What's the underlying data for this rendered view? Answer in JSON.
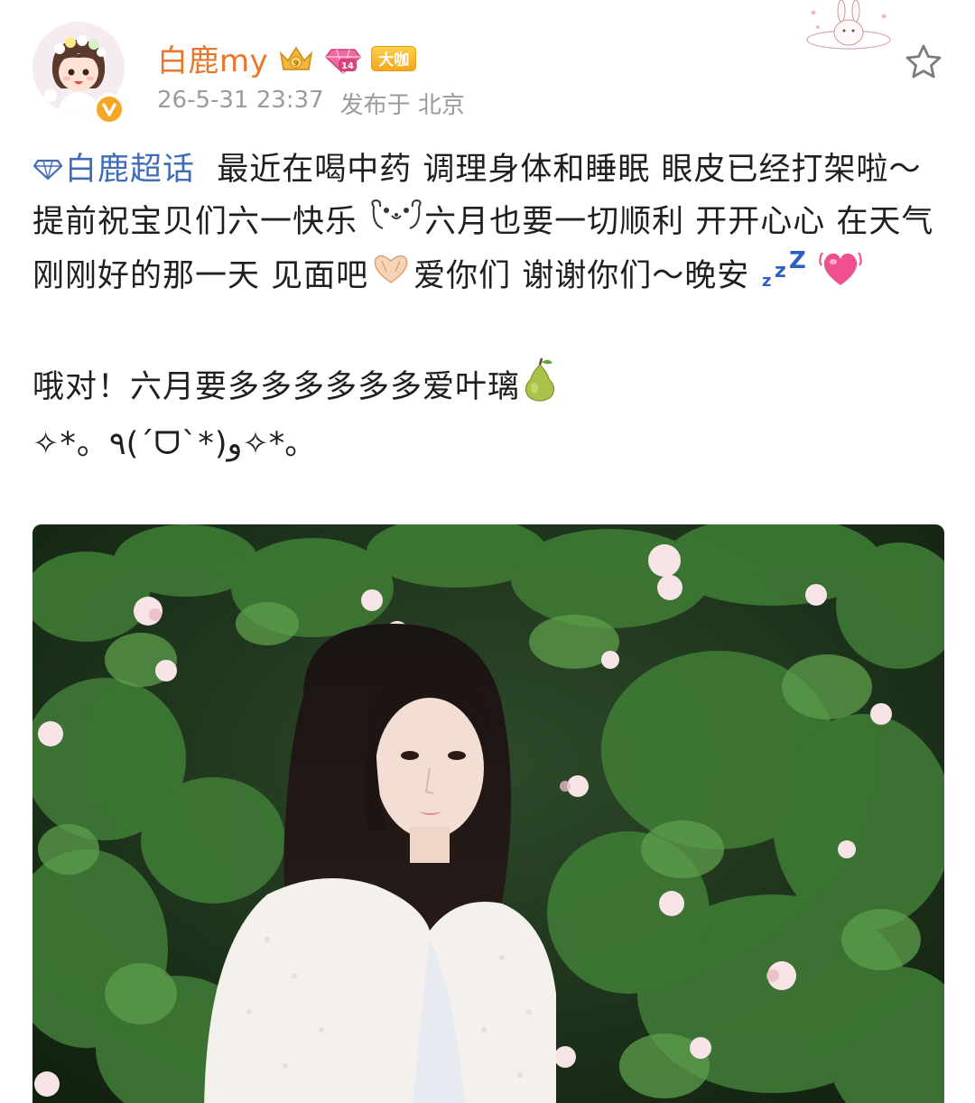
{
  "header": {
    "username": "白鹿my",
    "level_badge": "14",
    "daka_badge": "大咖",
    "timestamp": "26-5-31 23:37",
    "location": "发布于 北京"
  },
  "post": {
    "topic": "白鹿超话",
    "line1_rest": "最近在喝中药 调理身体和睡眠 眼皮已经打架啦～提前祝宝贝们六一快乐",
    "line2": "六月也要一切顺利 开开心心 在天气刚刚好的那一天 见面吧",
    "line3": "爱你们 谢谢你们～晚安",
    "para2": "哦对！六月要多多多多多多爱叶璃",
    "para3": "✧*。٩(ˊᗜˋ*)و✧*。"
  },
  "colors": {
    "username": "#e8772d",
    "topic": "#3f6dbb",
    "meta": "#9b9b9b",
    "text": "#1f1f1f"
  },
  "icons": [
    "verified-v-icon",
    "crown-icon",
    "gem-icon",
    "star-icon",
    "diamond-icon",
    "bear-emoji",
    "heart-hands-emoji",
    "sleep-zzz-emoji",
    "heart-emoji",
    "pear-emoji"
  ]
}
